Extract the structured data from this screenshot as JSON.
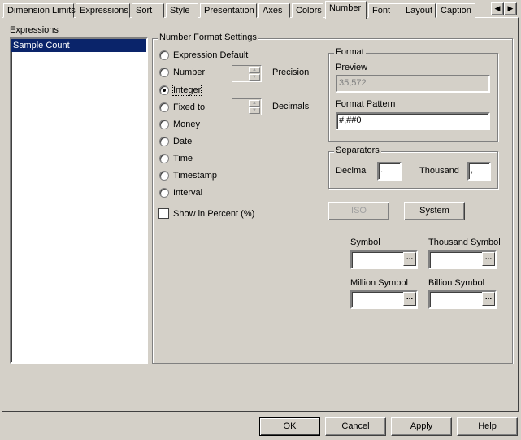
{
  "tabs": [
    "Dimension Limits",
    "Expressions",
    "Sort",
    "Style",
    "Presentation",
    "Axes",
    "Colors",
    "Number",
    "Font",
    "Layout",
    "Caption"
  ],
  "active_tab": "Number",
  "expressions": {
    "label": "Expressions",
    "items": [
      "Sample Count"
    ]
  },
  "number_format": {
    "title": "Number Format Settings",
    "options": [
      "Expression Default",
      "Number",
      "Integer",
      "Fixed to",
      "Money",
      "Date",
      "Time",
      "Timestamp",
      "Interval"
    ],
    "selected": "Integer",
    "precision_label": "Precision",
    "decimals_label": "Decimals",
    "show_percent": "Show in Percent (%)",
    "show_percent_checked": false
  },
  "format": {
    "title": "Format",
    "preview_label": "Preview",
    "preview_value": "35,572",
    "pattern_label": "Format Pattern",
    "pattern_value": "#,##0"
  },
  "separators": {
    "title": "Separators",
    "decimal_label": "Decimal",
    "decimal_value": ".",
    "thousand_label": "Thousand",
    "thousand_value": ","
  },
  "buttons": {
    "iso": "ISO",
    "system": "System",
    "ok": "OK",
    "cancel": "Cancel",
    "apply": "Apply",
    "help": "Help",
    "more": "..."
  },
  "symbols": {
    "symbol": "Symbol",
    "thousand": "Thousand Symbol",
    "million": "Million Symbol",
    "billion": "Billion Symbol"
  }
}
